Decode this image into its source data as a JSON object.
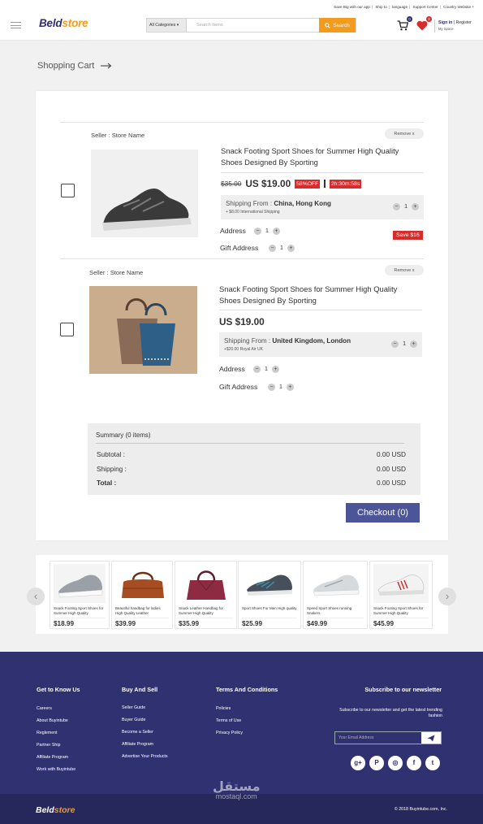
{
  "header": {
    "top_links": [
      "Save Big with our app",
      "Ship to",
      "language",
      "Support Center",
      "Country Website +"
    ],
    "logo_part1": "Beld",
    "logo_part2": "store",
    "search_category": "All Categories ▾",
    "search_placeholder": "Search items",
    "search_button": "Search",
    "cart_count": "0",
    "wishlist_count": "2",
    "sign_in": "Sign in",
    "register": "Register",
    "my_space": "My Space"
  },
  "page": {
    "title": "Shopping Cart"
  },
  "cart": {
    "items": [
      {
        "seller": "Seller : Store Name",
        "remove": "Remove x",
        "title": "Snack Footing Sport Shoes for Summer High Quality Shoes Designed By Sporting",
        "old_price": "$35.00",
        "price": "US $19.00",
        "discount": "58%OFF",
        "timer": "2h:30m:58s",
        "ship_label": "Shipping From : ",
        "ship_from": "China, Hong Kong",
        "ship_note": "+ $8.00  International Shipping",
        "qty": "1",
        "address_label": "Address",
        "address_qty": "1",
        "gift_label": "Gift Address",
        "gift_qty": "1",
        "save": "Save $16"
      },
      {
        "seller": "Seller : Store Name",
        "remove": "Remove x",
        "title": "Snack Footing Sport Shoes for Summer High Quality Shoes Designed By Sporting",
        "price": "US $19.00",
        "ship_label": "Shipping From : ",
        "ship_from": "United Kingdom, London",
        "ship_note": "+$20.00  Royal Air UK",
        "qty": "1",
        "address_label": "Address",
        "address_qty": "1",
        "gift_label": "Gift Address",
        "gift_qty": "1"
      }
    ],
    "summary": {
      "title": "Summary",
      "count": "(0 items)",
      "subtotal_label": "Subtotal :",
      "subtotal": "0.00 USD",
      "shipping_label": "Shipping :",
      "shipping": "0.00 USD",
      "total_label": "Total :",
      "total": "0.00 USD"
    },
    "checkout": "Checkout  (0)"
  },
  "recommendations": [
    {
      "name": "Snack Footing Sport Shoes for Summer High Quality",
      "price": "$18.99"
    },
    {
      "name": "Beautiful handbag for ladies High Quality Leather",
      "price": "$39.99"
    },
    {
      "name": "Snack Leather Handbag for Summer High Quality",
      "price": "$35.99"
    },
    {
      "name": "Sport Shoes For Men High quality",
      "price": "$25.99"
    },
    {
      "name": "Speed Sport Shoes running Snakers",
      "price": "$49.99"
    },
    {
      "name": "Snack Footing Sport Shoes for Summer High Quality",
      "price": "$45.99"
    }
  ],
  "footer": {
    "col1_title": "Get to Know Us",
    "col1": [
      "Careers",
      "About Buyintube",
      "Reglement",
      "Partner Ship",
      "Affiliate Program",
      "Work with Buyintube"
    ],
    "col2_title": "Buy And Sell",
    "col2": [
      "Seller Guide",
      "Buyer Guide",
      "Become a Seller",
      "Affiliate Program",
      "Advertise Your Products"
    ],
    "col3_title": "Terms And Conditions",
    "col3": [
      "Policies",
      "Terms of Use",
      "Privacy Policy"
    ],
    "news_title": "Subscribe to our newsletter",
    "news_desc": "Subscribe to our newsletter and get the latest trending fashion",
    "email_placeholder": "Your Email Address",
    "socials": [
      "g+",
      "P",
      "◎",
      "f",
      "t"
    ],
    "logo_part1": "Beld",
    "logo_part2": "store",
    "copyright": "© 2018 Buyintube.com, Inc.",
    "watermark": "مستقل",
    "watermark_url": "mostaql.com"
  }
}
